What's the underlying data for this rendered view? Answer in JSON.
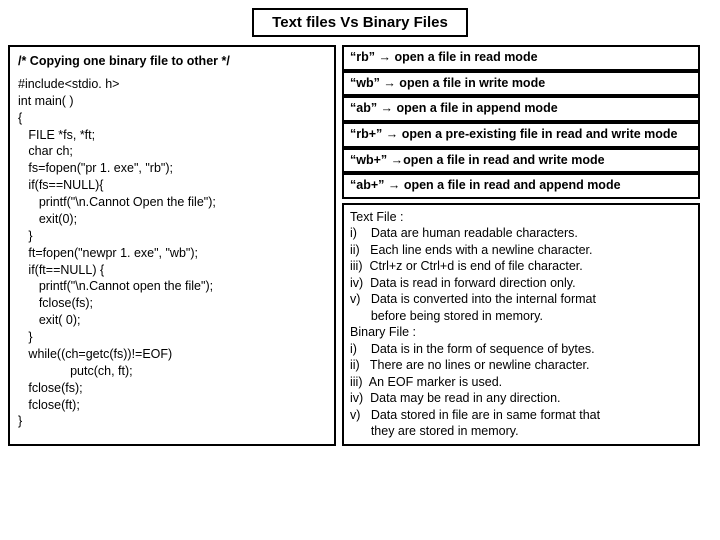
{
  "title": "Text files Vs Binary Files",
  "left": {
    "heading": "/* Copying one binary file to other */",
    "lines": [
      "#include<stdio. h>",
      "int main( )",
      "{",
      "   FILE *fs, *ft;",
      "   char ch;",
      "   fs=fopen(\"pr 1. exe\", \"rb\");",
      "   if(fs==NULL){",
      "      printf(\"\\n.Cannot Open the file\");",
      "      exit(0);",
      "   }",
      "   ft=fopen(\"newpr 1. exe\", \"wb\");",
      "   if(ft==NULL) {",
      "      printf(\"\\n.Cannot open the file\");",
      "      fclose(fs);",
      "      exit( 0);",
      "   }",
      "   while((ch=getc(fs))!=EOF)",
      "               putc(ch, ft);",
      "   fclose(fs);",
      "   fclose(ft);",
      "}"
    ]
  },
  "modes": [
    "“rb”    →   open a file in read mode",
    "“wb”    →  open a file in write mode",
    "“ab”    →   open a file in append mode",
    "“rb+”  →  open a pre-existing file in read  and write mode",
    "“wb+” →open a file in read and write mode",
    "“ab+”  →  open a file in read and append mode"
  ],
  "notes": {
    "text_heading": "Text File :",
    "text_items": [
      "i)    Data are human readable characters.",
      "ii)   Each line ends with a newline character.",
      "iii)  Ctrl+z or Ctrl+d is end of file character.",
      "iv)  Data is read in forward direction only.",
      "v)   Data is converted into the internal format",
      "      before being stored in memory."
    ],
    "binary_heading": "Binary File :",
    "binary_items": [
      "i)    Data is in the form of sequence of bytes.",
      "ii)   There are no lines or newline character.",
      "iii)  An EOF marker is used.",
      "iv)  Data may be read in any direction.",
      "v)   Data stored in file are in same format that",
      "      they are stored in memory."
    ]
  }
}
